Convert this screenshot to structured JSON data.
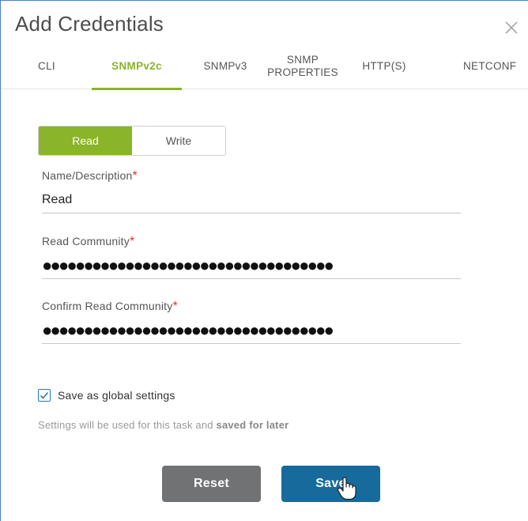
{
  "dialog": {
    "title": "Add Credentials",
    "close_icon": "close-icon"
  },
  "tabs": [
    {
      "label": "CLI",
      "active": false
    },
    {
      "label": "SNMPv2c",
      "active": true
    },
    {
      "label": "SNMPv3",
      "active": false
    },
    {
      "label_line1": "SNMP",
      "label_line2": "PROPERTIES",
      "active": false
    },
    {
      "label": "HTTP(S)",
      "active": false
    },
    {
      "label": "NETCONF",
      "active": false
    }
  ],
  "mode_toggle": {
    "read_label": "Read",
    "write_label": "Write",
    "selected": "Read"
  },
  "form": {
    "name": {
      "label": "Name/Description",
      "required_mark": "*",
      "value": "Read"
    },
    "community": {
      "label": "Read Community",
      "required_mark": "*",
      "value": "●●●●●●●●●●●●●●●●●●●●●●●●●●●●●●●●●●●"
    },
    "confirm": {
      "label": "Confirm Read Community",
      "required_mark": "*",
      "value": "●●●●●●●●●●●●●●●●●●●●●●●●●●●●●●●●●●●"
    }
  },
  "global_settings": {
    "checked": true,
    "label": "Save as global settings",
    "note_prefix": "Settings will be used for this task and ",
    "note_bold": "saved for later"
  },
  "actions": {
    "reset_label": "Reset",
    "save_label": "Save"
  },
  "colors": {
    "accent_green": "#8ab429",
    "save_blue": "#166b9c",
    "reset_gray": "#707274",
    "required_red": "#d9352c",
    "checkbox_blue": "#2a78b8"
  }
}
